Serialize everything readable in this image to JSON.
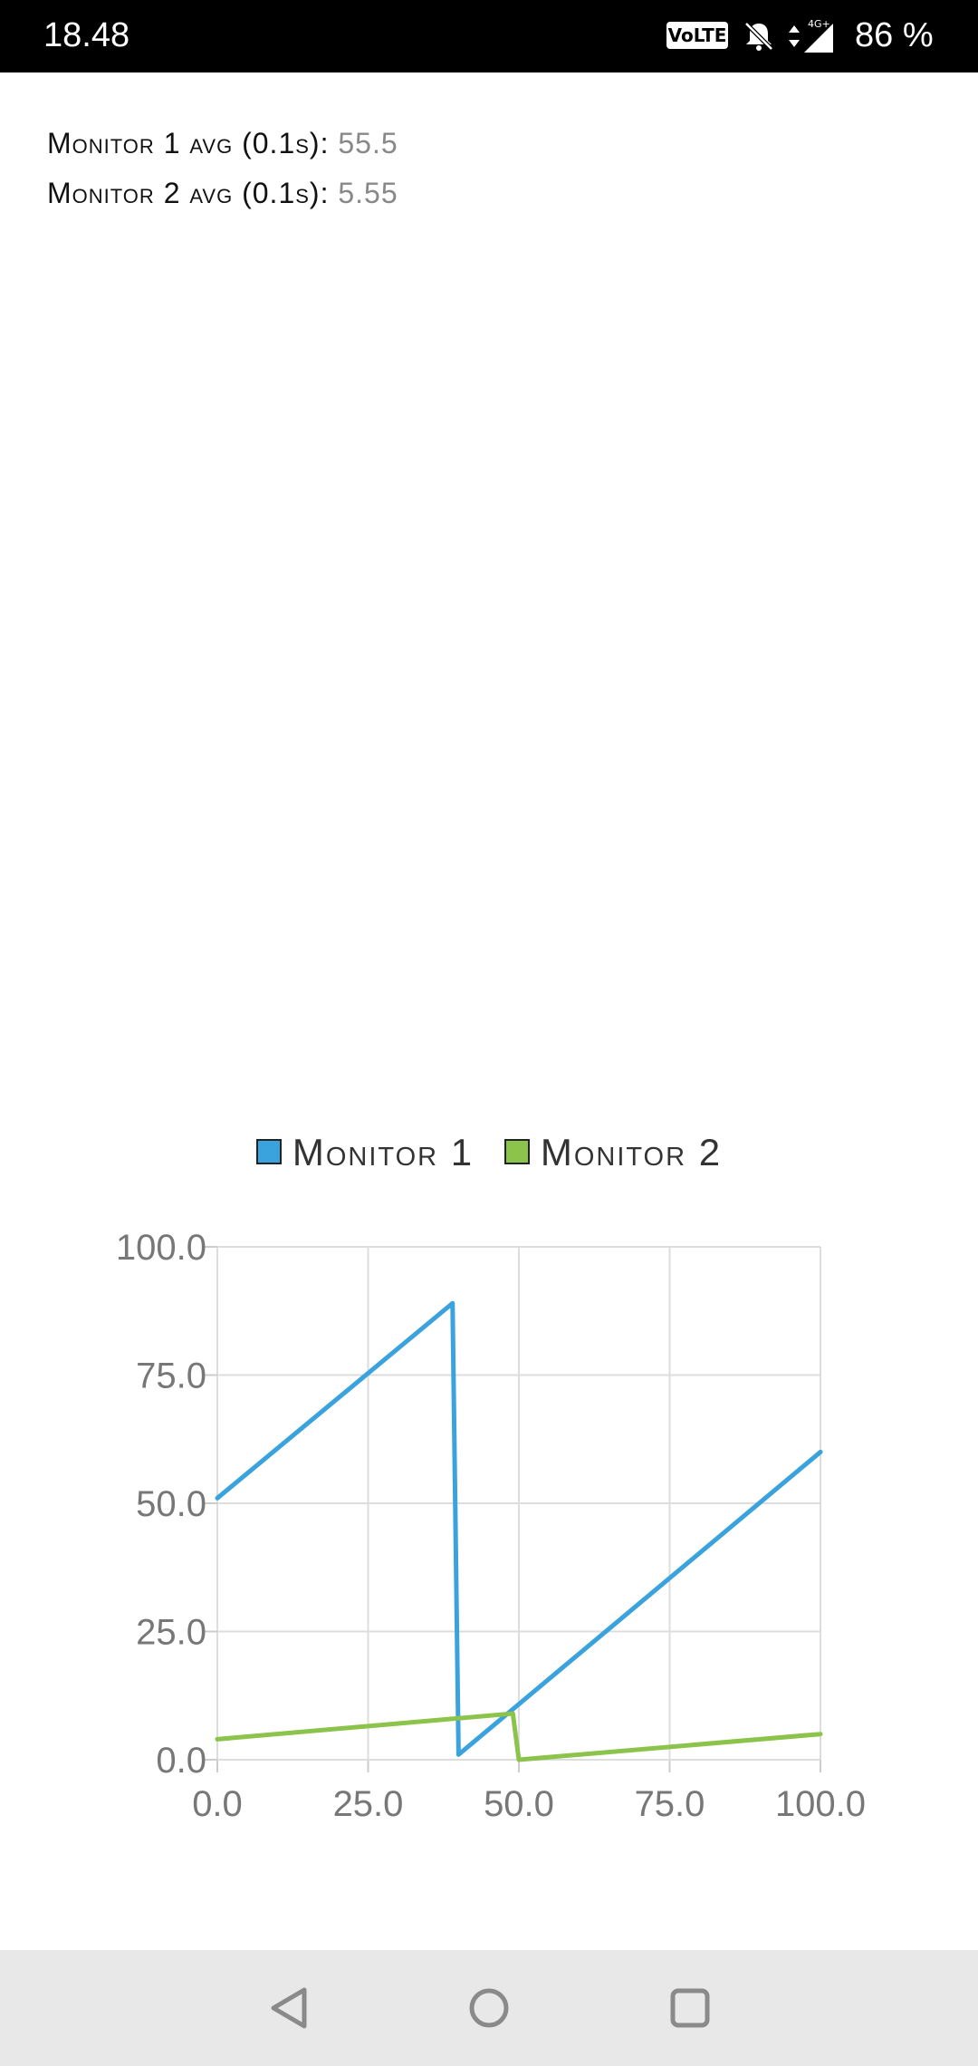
{
  "status_bar": {
    "time": "18.48",
    "volte": "VoLTE",
    "network": "4G+",
    "battery": "86 %"
  },
  "averages": {
    "monitor1_label": "Monitor 1 avg (0.1s):",
    "monitor1_value": "55.5",
    "monitor2_label": "Monitor 2 avg (0.1s):",
    "monitor2_value": "5.55"
  },
  "colors": {
    "monitor1": "#3aa3dd",
    "monitor2": "#8cc34a",
    "grid": "#dddddd",
    "axis": "#cccccc"
  },
  "chart_data": {
    "type": "line",
    "title": "",
    "xlabel": "",
    "ylabel": "",
    "xlim": [
      0,
      100
    ],
    "ylim": [
      0,
      100
    ],
    "xticks": [
      "0.0",
      "25.0",
      "50.0",
      "75.0",
      "100.0"
    ],
    "yticks": [
      "0.0",
      "25.0",
      "50.0",
      "75.0",
      "100.0"
    ],
    "grid": true,
    "legend": "top-center",
    "series": [
      {
        "name": "Monitor 1",
        "color": "#3aa3dd",
        "x": [
          0,
          39,
          40,
          100
        ],
        "y": [
          51,
          89,
          1,
          60
        ]
      },
      {
        "name": "Monitor 2",
        "color": "#8cc34a",
        "x": [
          0,
          49,
          50,
          100
        ],
        "y": [
          4,
          9,
          0,
          5
        ]
      }
    ]
  },
  "nav": {
    "back": "back-icon",
    "home": "home-icon",
    "recents": "recents-icon"
  }
}
